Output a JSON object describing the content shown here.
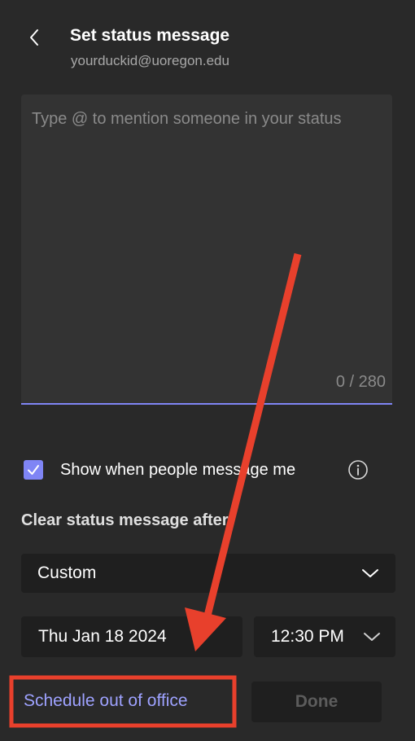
{
  "header": {
    "title": "Set status message",
    "account": "yourduckid@uoregon.edu"
  },
  "status_message": {
    "placeholder": "Type @ to mention someone in your status",
    "value": "",
    "counter": "0 / 280"
  },
  "show_when_messaged": {
    "label": "Show when people message me",
    "checked": true
  },
  "clear_after": {
    "label": "Clear status message after",
    "selected": "Custom",
    "date": "Thu Jan 18 2024",
    "time": "12:30 PM"
  },
  "footer": {
    "schedule_link": "Schedule out of office",
    "done_label": "Done"
  },
  "colors": {
    "background": "#292929",
    "accent": "#7f85f5",
    "link": "#9ea2ff",
    "annotation": "#e8402c"
  },
  "icons": {
    "back": "chevron-left-icon",
    "checkbox": "checkmark-icon",
    "info": "info-circle-icon",
    "dropdown": "chevron-down-icon"
  }
}
